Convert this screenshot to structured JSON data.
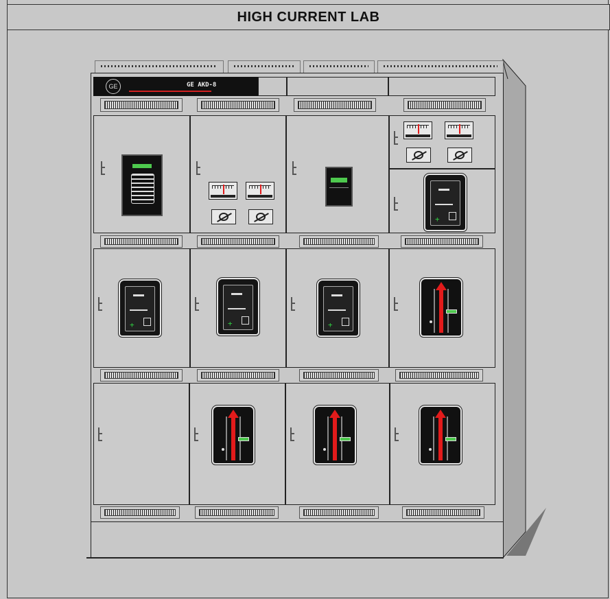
{
  "window": {
    "title": "HIGH CURRENT LAB"
  },
  "header_panel": {
    "logo_icon": "ge-monogram-icon",
    "model_text": "GE AKD-8",
    "accent_color": "#d22020"
  },
  "colors": {
    "background": "#c8c8c8",
    "closed_indicator": "#e21b1b",
    "status_green": "#2ecc40"
  },
  "cubicles": [
    {
      "column": 1,
      "row": 1,
      "device": "meter-relay"
    },
    {
      "column": 2,
      "row": 1,
      "device": "meters-and-switches"
    },
    {
      "column": 3,
      "row": 1,
      "device": "display-unit"
    },
    {
      "column": 4,
      "row": 1,
      "device": "meters-and-switches-with-breaker-open"
    },
    {
      "column": 1,
      "row": 2,
      "device": "breaker-open"
    },
    {
      "column": 2,
      "row": 2,
      "device": "breaker-open"
    },
    {
      "column": 3,
      "row": 2,
      "device": "breaker-open"
    },
    {
      "column": 4,
      "row": 2,
      "device": "breaker-closed"
    },
    {
      "column": 1,
      "row": 3,
      "device": "empty"
    },
    {
      "column": 2,
      "row": 3,
      "device": "breaker-closed"
    },
    {
      "column": 3,
      "row": 3,
      "device": "breaker-closed"
    },
    {
      "column": 4,
      "row": 3,
      "device": "breaker-closed"
    }
  ]
}
